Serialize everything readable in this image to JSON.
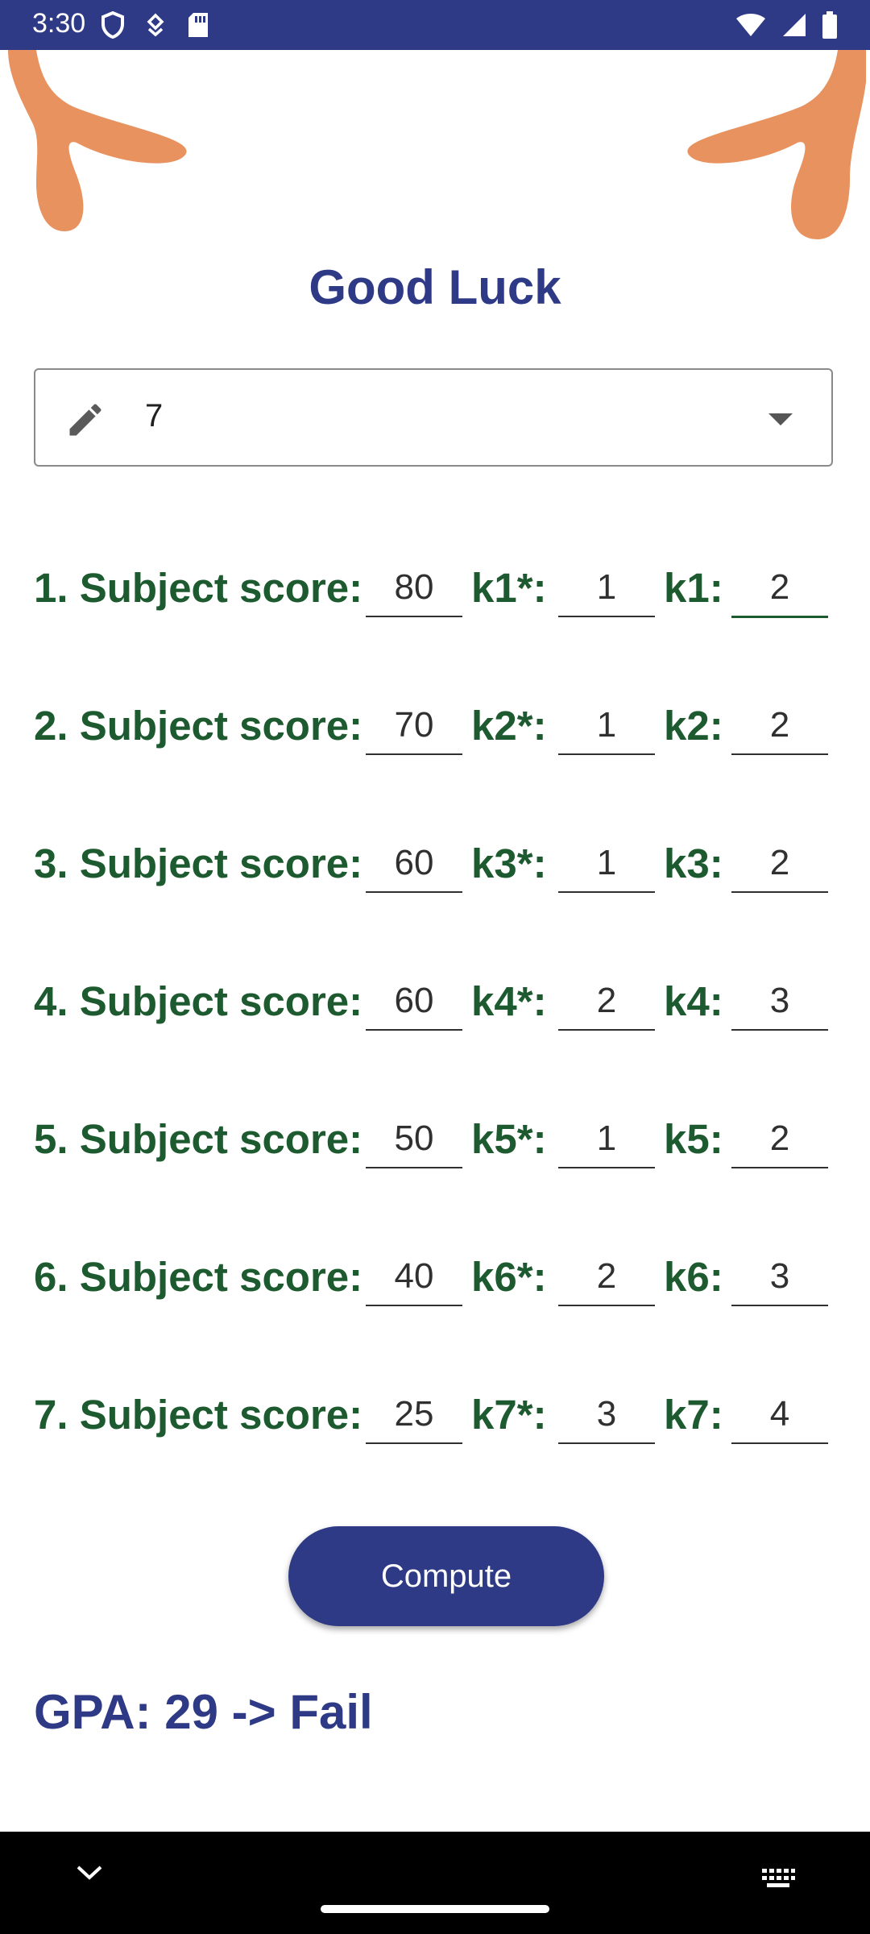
{
  "status_bar": {
    "time": "3:30"
  },
  "title": "Good Luck",
  "selector": {
    "value": "7"
  },
  "rows": [
    {
      "label": "1. Subject score:",
      "score": "80",
      "k_star_label": "k1*:",
      "k_star": "1",
      "k_label": "k1:",
      "k": "2"
    },
    {
      "label": "2. Subject score:",
      "score": "70",
      "k_star_label": "k2*:",
      "k_star": "1",
      "k_label": "k2:",
      "k": "2"
    },
    {
      "label": "3. Subject score:",
      "score": "60",
      "k_star_label": "k3*:",
      "k_star": "1",
      "k_label": "k3:",
      "k": "2"
    },
    {
      "label": "4. Subject score:",
      "score": "60",
      "k_star_label": "k4*:",
      "k_star": "2",
      "k_label": "k4:",
      "k": "3"
    },
    {
      "label": "5. Subject score:",
      "score": "50",
      "k_star_label": "k5*:",
      "k_star": "1",
      "k_label": "k5:",
      "k": "2"
    },
    {
      "label": "6. Subject score:",
      "score": "40",
      "k_star_label": "k6*:",
      "k_star": "2",
      "k_label": "k6:",
      "k": "3"
    },
    {
      "label": "7. Subject score:",
      "score": "25",
      "k_star_label": "k7*:",
      "k_star": "3",
      "k_label": "k7:",
      "k": "4"
    }
  ],
  "compute_button": "Compute",
  "result": "GPA: 29 -> Fail",
  "colors": {
    "primary": "#2e3a85",
    "label_green": "#1d5a2f",
    "decoration": "#e8925f"
  }
}
